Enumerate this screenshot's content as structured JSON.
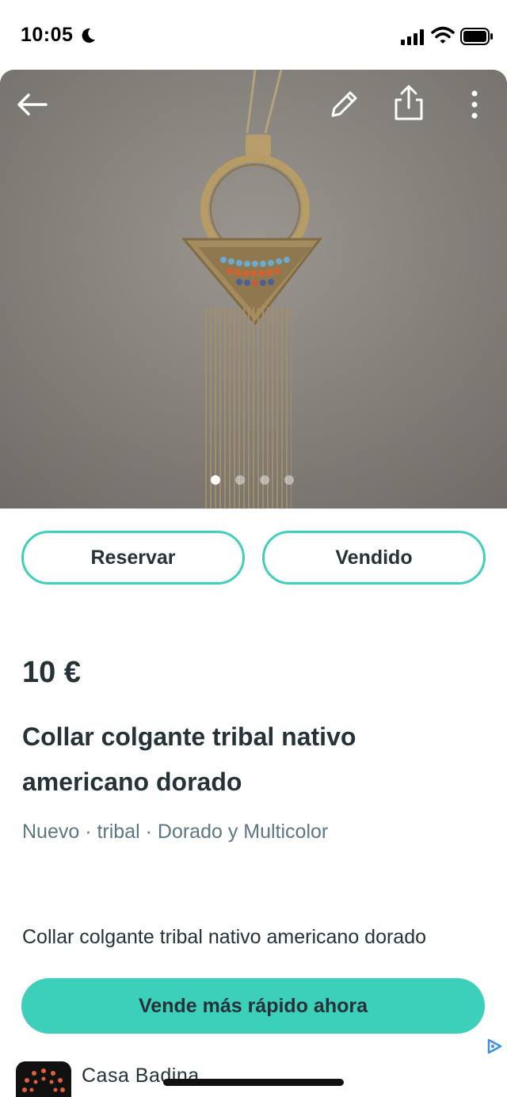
{
  "status_bar": {
    "time": "10:05",
    "icons": [
      "moon-icon",
      "signal-icon",
      "wifi-icon",
      "battery-icon"
    ]
  },
  "toolbar": {
    "icons": [
      "back-arrow-icon",
      "edit-pencil-icon",
      "share-icon",
      "more-vertical-icon"
    ]
  },
  "gallery": {
    "image_subject": "tribal pendant necklace photo",
    "page_count": 4,
    "current_page": 1
  },
  "actions": {
    "reserve_label": "Reservar",
    "sold_label": "Vendido"
  },
  "listing": {
    "price": "10 €",
    "title": "Collar colgante tribal nativo americano dorado",
    "attributes": [
      "Nuevo",
      "tribal",
      "Dorado y Multicolor"
    ],
    "attribute_separator": " · ",
    "description": "Collar colgante tribal nativo americano dorado"
  },
  "cta": {
    "label": "Vende más rápido ahora"
  },
  "ad": {
    "advertiser_name": "Casa Badina",
    "badge_icon": "adchoices-icon"
  },
  "colors": {
    "accent": "#3ccfba",
    "text": "#253238",
    "muted": "#5c7783"
  }
}
